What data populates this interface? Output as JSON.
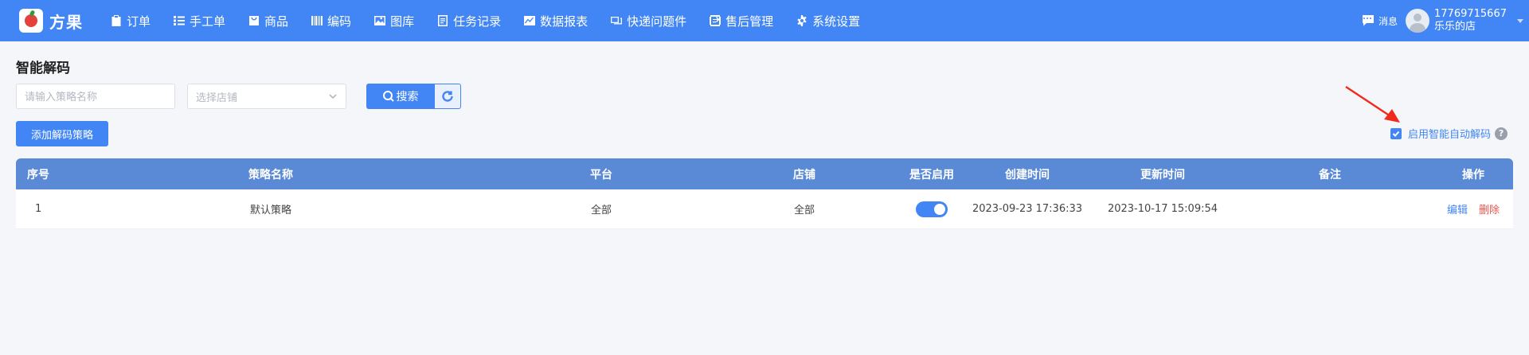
{
  "brand": {
    "name": "方果"
  },
  "nav": [
    {
      "label": "订单",
      "icon": "clipboard-icon"
    },
    {
      "label": "手工单",
      "icon": "list-icon"
    },
    {
      "label": "商品",
      "icon": "bag-icon"
    },
    {
      "label": "编码",
      "icon": "barcode-icon"
    },
    {
      "label": "图库",
      "icon": "image-icon"
    },
    {
      "label": "任务记录",
      "icon": "document-icon"
    },
    {
      "label": "数据报表",
      "icon": "chart-icon"
    },
    {
      "label": "快递问题件",
      "icon": "package-icon"
    },
    {
      "label": "售后管理",
      "icon": "exchange-icon"
    },
    {
      "label": "系统设置",
      "icon": "gear-icon"
    }
  ],
  "header": {
    "messages_label": "消息",
    "phone": "17769715667",
    "store": "乐乐的店"
  },
  "page": {
    "title": "智能解码"
  },
  "search": {
    "placeholder": "请输入策略名称",
    "value": ""
  },
  "store_select": {
    "placeholder": "选择店铺"
  },
  "buttons": {
    "search": "搜索",
    "add": "添加解码策略"
  },
  "auto_decode": {
    "label": "启用智能自动解码",
    "checked": true,
    "help": "?"
  },
  "table": {
    "headers": [
      "序号",
      "策略名称",
      "平台",
      "店铺",
      "是否启用",
      "创建时间",
      "更新时间",
      "备注",
      "操作"
    ],
    "rows": [
      {
        "seq": "1",
        "name": "默认策略",
        "platform": "全部",
        "store": "全部",
        "enabled": true,
        "created": "2023-09-23 17:36:33",
        "updated": "2023-10-17 15:09:54",
        "remark": "",
        "edit": "编辑",
        "delete": "删除"
      }
    ]
  },
  "colors": {
    "primary": "#4286f5",
    "header_bg": "#5a8ad6",
    "danger": "#f5534a",
    "annotation_arrow": "#f02b1d"
  }
}
